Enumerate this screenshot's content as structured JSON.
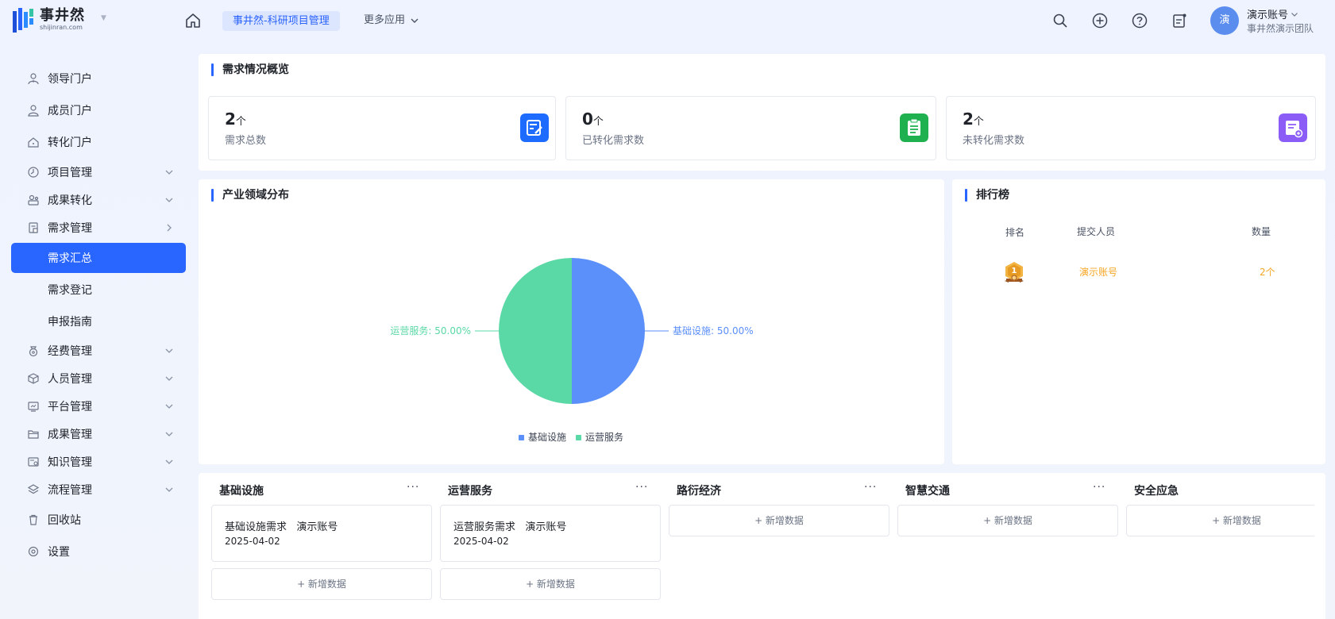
{
  "header": {
    "logo_cn": "事井然",
    "logo_en": "shijinran.com",
    "active_app": "事井然-科研项目管理",
    "more_apps": "更多应用",
    "user_avatar_text": "演",
    "user_name": "演示账号",
    "user_team": "事井然演示团队",
    "icons": [
      "home-icon",
      "search-icon",
      "plus-circle-icon",
      "help-icon",
      "notice-icon"
    ]
  },
  "sidebar": {
    "items": [
      {
        "label": "领导门户",
        "icon": "user-tie-icon",
        "arrow": ""
      },
      {
        "label": "成员门户",
        "icon": "user-icon",
        "arrow": ""
      },
      {
        "label": "转化门户",
        "icon": "home-outline-icon",
        "arrow": ""
      },
      {
        "label": "项目管理",
        "icon": "clock-icon",
        "arrow": "down"
      },
      {
        "label": "成果转化",
        "icon": "transfer-icon",
        "arrow": "down"
      },
      {
        "label": "需求管理",
        "icon": "clipboard-icon",
        "arrow": "right"
      },
      {
        "label": "需求汇总",
        "sub": true,
        "active": true
      },
      {
        "label": "需求登记",
        "sub": true
      },
      {
        "label": "申报指南",
        "sub": true
      },
      {
        "label": "经费管理",
        "icon": "money-bag-icon",
        "arrow": "down"
      },
      {
        "label": "人员管理",
        "icon": "cube-icon",
        "arrow": "down"
      },
      {
        "label": "平台管理",
        "icon": "monitor-icon",
        "arrow": "down"
      },
      {
        "label": "成果管理",
        "icon": "folder-icon",
        "arrow": "down"
      },
      {
        "label": "知识管理",
        "icon": "book-icon",
        "arrow": "down"
      },
      {
        "label": "流程管理",
        "icon": "layers-icon",
        "arrow": "down"
      },
      {
        "label": "回收站",
        "icon": "trash-icon",
        "arrow": ""
      },
      {
        "label": "设置",
        "icon": "settings-icon",
        "arrow": ""
      }
    ]
  },
  "overview": {
    "title": "需求情况概览",
    "stats": [
      {
        "value": "2",
        "unit": "个",
        "label": "需求总数",
        "color": "#1e6bff"
      },
      {
        "value": "0",
        "unit": "个",
        "label": "已转化需求数",
        "color": "#1fb04f"
      },
      {
        "value": "2",
        "unit": "个",
        "label": "未转化需求数",
        "color": "#8b5cf6"
      }
    ]
  },
  "industry": {
    "title": "产业领域分布",
    "label_left": "运营服务: 50.00%",
    "label_right": "基础设施: 50.00%",
    "legend": [
      "基础设施",
      "运营服务"
    ]
  },
  "chart_data": {
    "type": "pie",
    "title": "产业领域分布",
    "categories": [
      "基础设施",
      "运营服务"
    ],
    "values": [
      50,
      50
    ],
    "colors": [
      "#5b8ff9",
      "#5ad8a6"
    ],
    "legend": "bottom"
  },
  "ranking": {
    "title": "排行榜",
    "headers": [
      "排名",
      "提交人员",
      "数量"
    ],
    "rows": [
      {
        "rank": "1",
        "name": "演示账号",
        "count": "2个"
      }
    ]
  },
  "kanban": {
    "columns": [
      {
        "title": "基础设施",
        "cards": [
          {
            "title": "基础设施需求   演示账号",
            "date": "2025-04-02"
          }
        ],
        "add_label": "+ 新增数据"
      },
      {
        "title": "运营服务",
        "cards": [
          {
            "title": "运营服务需求   演示账号",
            "date": "2025-04-02"
          }
        ],
        "add_label": "+ 新增数据"
      },
      {
        "title": "路衍经济",
        "cards": [],
        "add_label": "+ 新增数据"
      },
      {
        "title": "智慧交通",
        "cards": [],
        "add_label": "+ 新增数据"
      },
      {
        "title": "安全应急",
        "cards": [],
        "add_label": "+ 新增数据"
      }
    ],
    "more_symbol": "···"
  }
}
